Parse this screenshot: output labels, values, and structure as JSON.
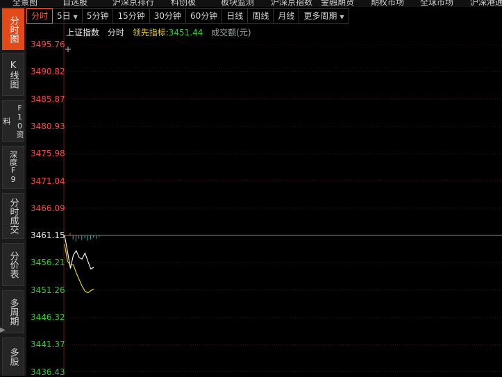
{
  "top_menu": [
    "全景图",
    "自选股",
    "沪深京排行",
    "科创板",
    "板块监测",
    "沪深京指数",
    "金融期货",
    "期权市场",
    "全球市场",
    "沪深港通"
  ],
  "sidebar": {
    "tabs": [
      {
        "label": "分时图",
        "active": true
      },
      {
        "label": "K线图",
        "active": false
      },
      {
        "label": "F10资料",
        "active": false
      },
      {
        "label": "深度F9",
        "active": false
      },
      {
        "label": "分时成交",
        "active": false
      },
      {
        "label": "分价表",
        "active": false
      },
      {
        "label": "多周期",
        "active": false
      },
      {
        "label": "多股",
        "active": false
      }
    ]
  },
  "toolbar": {
    "buttons": [
      {
        "label": "分时",
        "active": true,
        "dropdown": false
      },
      {
        "label": "5日",
        "active": false,
        "dropdown": true
      },
      {
        "label": "5分钟",
        "active": false,
        "dropdown": false
      },
      {
        "label": "15分钟",
        "active": false,
        "dropdown": false
      },
      {
        "label": "30分钟",
        "active": false,
        "dropdown": false
      },
      {
        "label": "60分钟",
        "active": false,
        "dropdown": false
      },
      {
        "label": "日线",
        "active": false,
        "dropdown": false
      },
      {
        "label": "周线",
        "active": false,
        "dropdown": false
      },
      {
        "label": "月线",
        "active": false,
        "dropdown": false
      },
      {
        "label": "更多周期",
        "active": false,
        "dropdown": true
      }
    ]
  },
  "info": {
    "index_name": "上证指数",
    "mode": "分时",
    "lead_label": "领先指标:",
    "lead_value": "3451.44",
    "volume_label": "成交额(元)"
  },
  "axis": {
    "labels": [
      "3495.76",
      "3490.82",
      "3485.87",
      "3480.93",
      "3475.98",
      "3471.04",
      "3466.09",
      "3461.15",
      "3456.21",
      "3451.26",
      "3446.32",
      "3441.37",
      "3436.43"
    ],
    "reference": 3461.15,
    "min": 3436.43,
    "max": 3495.76
  },
  "colors": {
    "up": "#ff4646",
    "down": "#2fcf2f",
    "ref": "#e6e6e6",
    "price_line": "#ffffff",
    "avg_line": "#f2e400",
    "grid": "#3a1010",
    "accent": "#e24a1a"
  },
  "chart_data": {
    "type": "line",
    "series": [
      {
        "values": [
          3461.15,
          3458.3,
          3455.2,
          3457.6,
          3458.4,
          3457.2,
          3456.9,
          3458.0,
          3456.5,
          3455.1,
          3455.4
        ]
      },
      {
        "values": [
          3459.6,
          3456.5,
          3455.8,
          3455.9,
          3454.4,
          3453.2,
          3452.0,
          3451.1,
          3450.8,
          3451.2,
          3451.5
        ]
      }
    ],
    "bars": [
      1,
      0.6,
      0.9,
      0.5,
      0.7,
      0.4,
      0.8,
      0.6,
      0.3,
      0.5,
      0.2
    ],
    "bar_dir": [
      "up",
      "down",
      "down",
      "down",
      "down",
      "down",
      "down",
      "down",
      "down",
      "down",
      "down"
    ]
  }
}
